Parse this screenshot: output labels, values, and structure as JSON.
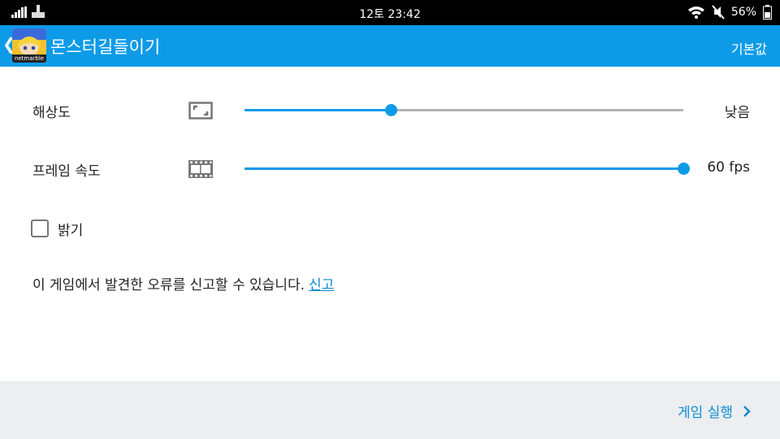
{
  "status_bar": {
    "time": "12토 23:42",
    "battery": "56%",
    "icons": [
      "signal-icon",
      "usb-debug-icon",
      "wifi-icon",
      "mute-icon",
      "battery-icon"
    ]
  },
  "app_bar": {
    "title": "몬스터길들이기",
    "default_button": "기본값",
    "back_icon": "chevron-left-icon",
    "app_icon_label": "netmarble"
  },
  "settings": {
    "resolution": {
      "label": "해상도",
      "value": "낮음",
      "level": 0.333,
      "icon": "aspect-ratio-icon"
    },
    "frame_rate": {
      "label": "프레임 속도",
      "value": "60 fps",
      "level": 1.0,
      "icon": "film-strip-icon"
    },
    "brightness": {
      "label": "밝기",
      "checked": false
    }
  },
  "report": {
    "text": "이 게임에서 발견한 오류를 신고할 수 있습니다.",
    "link": "신고"
  },
  "footer": {
    "launch_button": "게임 실행",
    "launch_icon": "chevron-right-icon"
  },
  "colors": {
    "accent": "#0d9be8",
    "link": "#0d8bd4",
    "track": "#b4b4b4",
    "footer_bg": "#eceef0"
  }
}
